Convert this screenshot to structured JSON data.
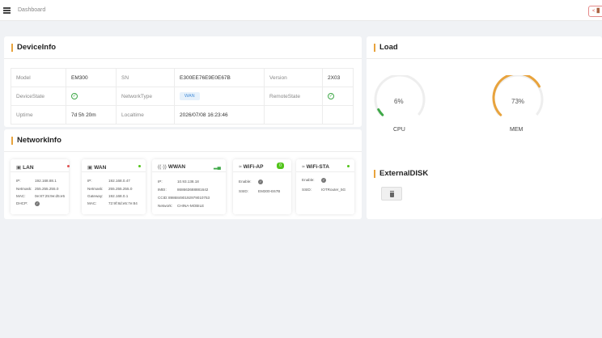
{
  "topbar": {
    "breadcrumb": "Dashboard",
    "action_icon": "exit-icon",
    "action_label": "<🚪"
  },
  "device_info": {
    "title": "DeviceInfo",
    "model_label": "Model",
    "model": "EM300",
    "sn_label": "SN",
    "sn": "E300EE76E9E0E67B",
    "version_label": "Version",
    "version": "2X03",
    "devicestate_label": "DeviceState",
    "devicestate_icon": "check-circle-icon",
    "networktype_label": "NetworkType",
    "networktype": "WAN",
    "remotestate_label": "RemoteState",
    "remotestate_icon": "check-circle-icon",
    "uptime_label": "Uptime",
    "uptime": "7d 5h 20m",
    "localtime_label": "Localtime",
    "localtime": "2026/07/08 16:23:46"
  },
  "network_info": {
    "title": "NetworkInfo",
    "lan": {
      "title": "LAN",
      "status_color": "#e05252",
      "ip_label": "IP:",
      "ip": "192.168.88.1",
      "netmask_label": "Netmask:",
      "netmask": "255.255.255.0",
      "mac_label": "MAC:",
      "mac": "0e:87:25:9e:d5:e5",
      "dhcp_label": "DHCP:"
    },
    "wan": {
      "title": "WAN",
      "status_color": "#52c41a",
      "ip_label": "IP:",
      "ip": "192.168.0.47",
      "netmask_label": "Netmask:",
      "netmask": "255.255.255.0",
      "gateway_label": "Gateway:",
      "gateway": "192.168.0.1",
      "mac_label": "MAC:",
      "mac": "72:9f:8d:e5:7e:84"
    },
    "wwan": {
      "title": "WWAN",
      "ip_label": "IP:",
      "ip": "10.93.138.18",
      "imei_label": "IMEI:",
      "imei": "868663688881642",
      "ccid_label": "CCID:",
      "ccid": "89868490192979010753",
      "network_label": "Network:",
      "network": "CHINA-MOBILE"
    },
    "wifi_ap": {
      "title": "WiFi-AP",
      "badge": "0",
      "enable_label": "Enable:",
      "ssid_label": "SSID:",
      "ssid": "EM300-E67B"
    },
    "wifi_sta": {
      "title": "WiFi-STA",
      "status_color": "#52c41a",
      "enable_label": "Enable:",
      "ssid_label": "SSID:",
      "ssid": "IOTRouter_5G"
    }
  },
  "load": {
    "title": "Load",
    "cpu": {
      "label": "CPU",
      "value_text": "6%",
      "percent": 6,
      "color": "#3fa848"
    },
    "mem": {
      "label": "MEM",
      "value_text": "73%",
      "percent": 73,
      "color": "#e8a33d"
    }
  },
  "external_disk": {
    "title": "ExternalDISK",
    "button_icon": "trash-icon"
  }
}
